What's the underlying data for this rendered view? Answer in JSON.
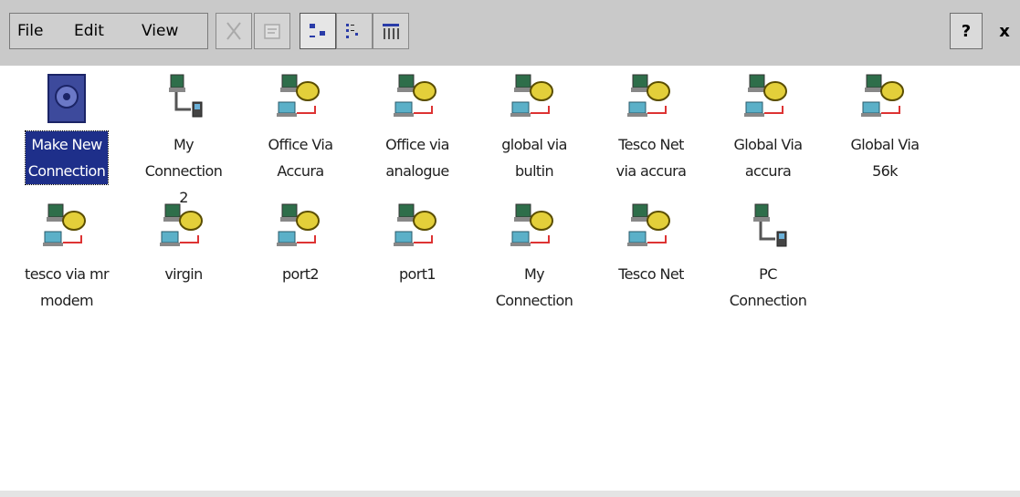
{
  "menu": {
    "file": "File",
    "edit": "Edit",
    "view": "View"
  },
  "toolbar": {
    "cut_icon": "cut-icon",
    "properties_icon": "properties-icon",
    "large_icons_icon": "large-icons-icon",
    "list_icon": "list-icon",
    "details_icon": "details-icon",
    "help_label": "?",
    "close_label": "x"
  },
  "items": [
    {
      "label": "Make New\nConnection",
      "icon": "make-new-connection-icon",
      "selected": true
    },
    {
      "label": "My\nConnection\n2",
      "icon": "direct-connection-icon"
    },
    {
      "label": "Office Via\nAccura",
      "icon": "dialup-connection-icon"
    },
    {
      "label": "Office via\nanalogue",
      "icon": "dialup-connection-icon"
    },
    {
      "label": "global via\nbultin",
      "icon": "dialup-connection-icon"
    },
    {
      "label": "Tesco Net\nvia accura",
      "icon": "dialup-connection-icon"
    },
    {
      "label": "Global Via\naccura",
      "icon": "dialup-connection-icon"
    },
    {
      "label": "Global Via\n56k",
      "icon": "dialup-connection-icon"
    },
    {
      "label": "tesco via mr\nmodem",
      "icon": "dialup-connection-icon"
    },
    {
      "label": "virgin",
      "icon": "dialup-connection-icon"
    },
    {
      "label": "port2",
      "icon": "dialup-connection-icon"
    },
    {
      "label": "port1",
      "icon": "dialup-connection-icon"
    },
    {
      "label": "My\nConnection",
      "icon": "dialup-connection-icon"
    },
    {
      "label": "Tesco Net",
      "icon": "dialup-connection-icon"
    },
    {
      "label": "PC\nConnection",
      "icon": "direct-connection-icon"
    }
  ]
}
